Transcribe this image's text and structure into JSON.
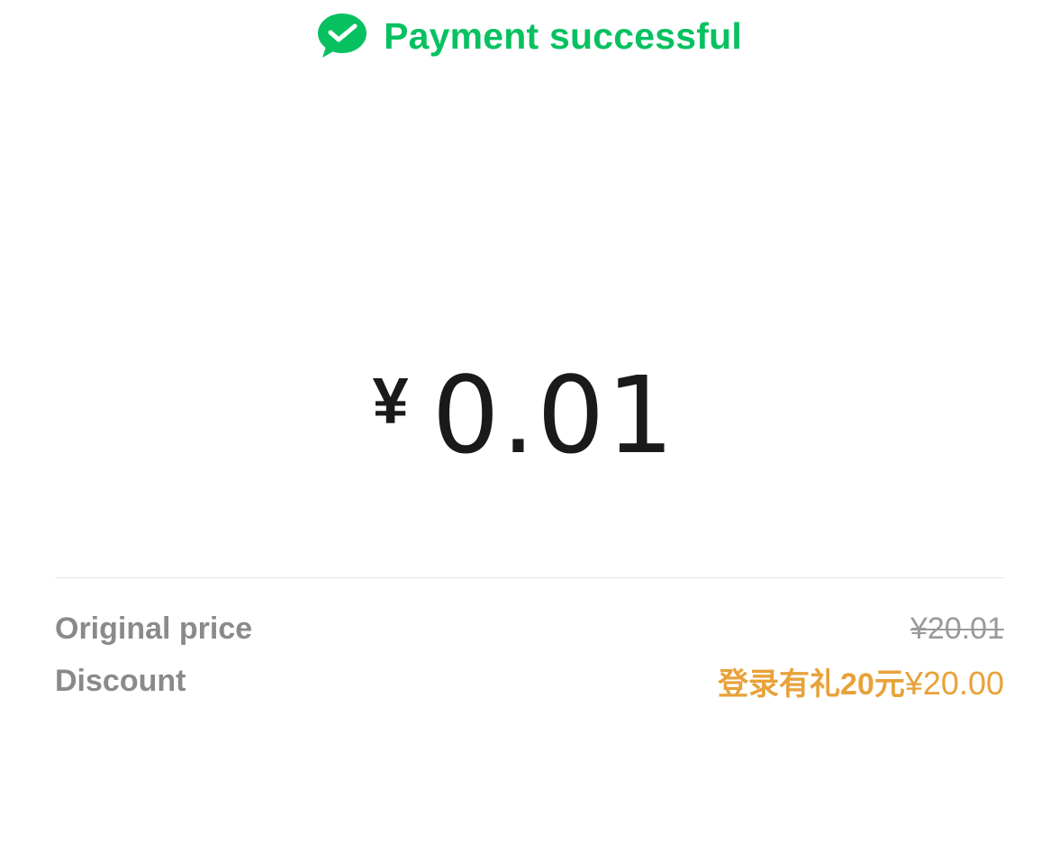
{
  "header": {
    "icon": "wechat-pay-check-icon",
    "title": "Payment successful"
  },
  "amount": {
    "currency": "¥",
    "value": "0.01"
  },
  "details": {
    "original_price": {
      "label": "Original price",
      "value": "¥20.01"
    },
    "discount": {
      "label": "Discount",
      "promo_name": "登录有礼20元",
      "value": "¥20.00"
    }
  },
  "colors": {
    "brand_green": "#07c160",
    "discount_orange": "#e8a23a",
    "label_gray": "#8a8a8a",
    "amount_text": "#1a1a1a"
  }
}
